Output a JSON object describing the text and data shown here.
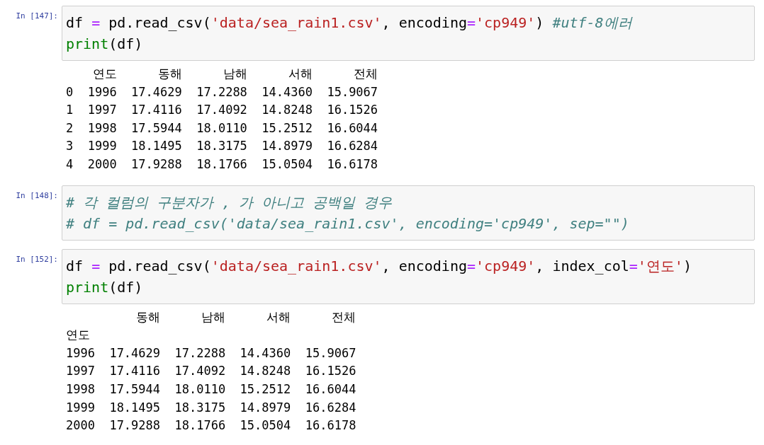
{
  "cells": [
    {
      "prompt": "In [147]:",
      "code": [
        [
          {
            "kind": "plain",
            "text": "df "
          },
          {
            "kind": "op",
            "text": "="
          },
          {
            "kind": "plain",
            "text": " pd.read_csv("
          },
          {
            "kind": "string",
            "text": "'data/sea_rain1.csv'"
          },
          {
            "kind": "plain",
            "text": ", encoding"
          },
          {
            "kind": "op",
            "text": "="
          },
          {
            "kind": "string",
            "text": "'cp949'"
          },
          {
            "kind": "plain",
            "text": ") "
          },
          {
            "kind": "comment",
            "text": "#utf-8에러"
          }
        ],
        [
          {
            "kind": "builtin",
            "text": "print"
          },
          {
            "kind": "plain",
            "text": "(df)"
          }
        ]
      ],
      "output": {
        "columns": [
          "",
          "연도",
          "동해",
          "남해",
          "서해",
          "전체"
        ],
        "rows": [
          [
            "0",
            "1996",
            "17.4629",
            "17.2288",
            "14.4360",
            "15.9067"
          ],
          [
            "1",
            "1997",
            "17.4116",
            "17.4092",
            "14.8248",
            "16.1526"
          ],
          [
            "2",
            "1998",
            "17.5944",
            "18.0110",
            "15.2512",
            "16.6044"
          ],
          [
            "3",
            "1999",
            "18.1495",
            "18.3175",
            "14.8979",
            "16.6284"
          ],
          [
            "4",
            "2000",
            "17.9288",
            "18.1766",
            "15.0504",
            "16.6178"
          ]
        ]
      }
    },
    {
      "prompt": "In [148]:",
      "code": [
        [
          {
            "kind": "comment",
            "text": "# 각 컬럼의 구분자가 , 가 아니고 공백일 경우"
          }
        ],
        [
          {
            "kind": "comment",
            "text": "# df = pd.read_csv('data/sea_rain1.csv', encoding='cp949', sep=\"\")"
          }
        ]
      ]
    },
    {
      "prompt": "In [152]:",
      "code": [
        [
          {
            "kind": "plain",
            "text": "df "
          },
          {
            "kind": "op",
            "text": "="
          },
          {
            "kind": "plain",
            "text": " pd.read_csv("
          },
          {
            "kind": "string",
            "text": "'data/sea_rain1.csv'"
          },
          {
            "kind": "plain",
            "text": ", encoding"
          },
          {
            "kind": "op",
            "text": "="
          },
          {
            "kind": "string",
            "text": "'cp949'"
          },
          {
            "kind": "plain",
            "text": ", index_col"
          },
          {
            "kind": "op",
            "text": "="
          },
          {
            "kind": "string",
            "text": "'연도'"
          },
          {
            "kind": "plain",
            "text": ")"
          }
        ],
        [
          {
            "kind": "builtin",
            "text": "print"
          },
          {
            "kind": "plain",
            "text": "(df)"
          }
        ]
      ],
      "output": {
        "index_name": "연도",
        "columns": [
          "",
          "동해",
          "남해",
          "서해",
          "전체"
        ],
        "rows": [
          [
            "1996",
            "17.4629",
            "17.2288",
            "14.4360",
            "15.9067"
          ],
          [
            "1997",
            "17.4116",
            "17.4092",
            "14.8248",
            "16.1526"
          ],
          [
            "1998",
            "17.5944",
            "18.0110",
            "15.2512",
            "16.6044"
          ],
          [
            "1999",
            "18.1495",
            "18.3175",
            "14.8979",
            "16.6284"
          ],
          [
            "2000",
            "17.9288",
            "18.1766",
            "15.0504",
            "16.6178"
          ]
        ]
      }
    }
  ]
}
